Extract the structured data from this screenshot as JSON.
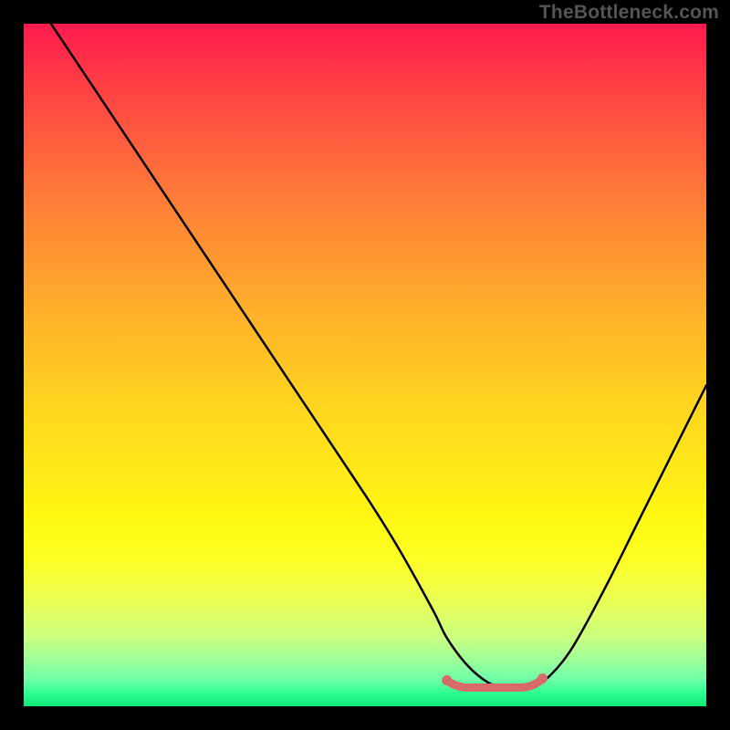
{
  "watermark": "TheBottleneck.com",
  "chart_data": {
    "type": "line",
    "title": "",
    "xlabel": "",
    "ylabel": "",
    "xlim": [
      0,
      100
    ],
    "ylim": [
      0,
      100
    ],
    "grid": false,
    "legend": false,
    "series": [
      {
        "name": "bottleneck-curve",
        "x": [
          4,
          10,
          20,
          30,
          40,
          50,
          55,
          60,
          62,
          65,
          68,
          70,
          72,
          74,
          76,
          80,
          85,
          90,
          95,
          100
        ],
        "y": [
          100,
          91,
          76,
          61,
          46,
          31,
          23,
          14,
          10,
          6,
          3.5,
          3,
          3,
          3,
          3.5,
          8,
          17,
          27,
          37,
          47
        ]
      }
    ],
    "highlight_region": {
      "name": "optimal-range",
      "x": [
        62,
        76
      ],
      "y_approx": 3,
      "color": "#d86a6a"
    },
    "background": "red-yellow-green-vertical-gradient"
  }
}
